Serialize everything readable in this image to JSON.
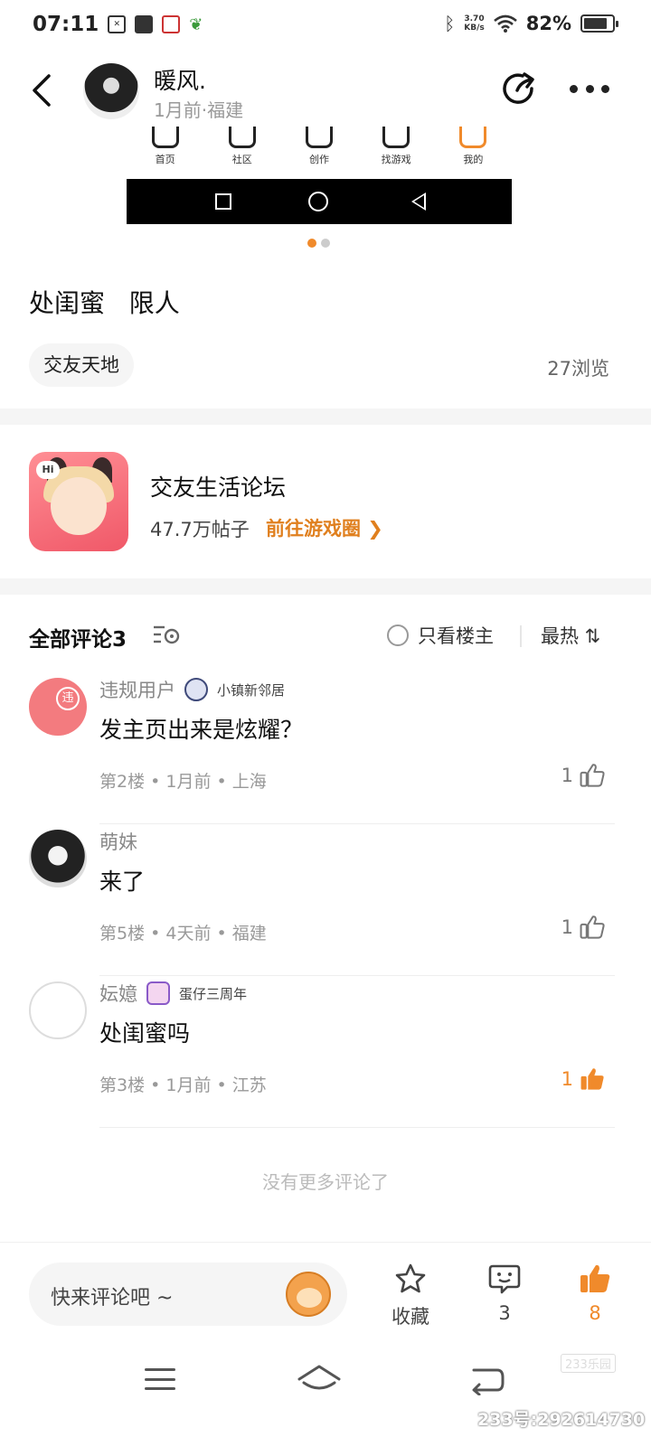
{
  "status_bar": {
    "time": "07:11",
    "speed_value": "3.70",
    "speed_unit": "KB/s",
    "battery_percent": "82%",
    "battery_level": 0.82
  },
  "author": {
    "name": "暖风.",
    "meta": "1月前·福建"
  },
  "embedded_screenshot": {
    "tabs": [
      {
        "label": "首页",
        "icon": "home-icon"
      },
      {
        "label": "社区",
        "icon": "community-icon"
      },
      {
        "label": "创作",
        "icon": "create-icon"
      },
      {
        "label": "找游戏",
        "icon": "gamepad-icon"
      },
      {
        "label": "我的",
        "icon": "profile-icon",
        "active": true
      }
    ]
  },
  "post": {
    "title": "处闺蜜   限人",
    "topic": "交友天地",
    "views": "27浏览"
  },
  "circle": {
    "name": "交友生活论坛",
    "posts": "47.7万帖子",
    "link": "前往游戏圈 ❯",
    "icon_badge": "Hi"
  },
  "comments_header": {
    "title": "全部评论3",
    "only_op": "只看楼主",
    "sort": "最热 ⇅"
  },
  "comments": [
    {
      "name": "违规用户",
      "badge": "小镇新邻居",
      "text": "发主页出来是炫耀？",
      "meta": "第2楼 • 1月前 • 上海",
      "likes": "1",
      "liked": false,
      "avatar_char": "违"
    },
    {
      "name": "萌妹",
      "badge": "",
      "text": "来了",
      "meta": "第5楼 • 4天前 • 福建",
      "likes": "1",
      "liked": false
    },
    {
      "name": "妘嬑",
      "badge": "蛋仔三周年",
      "text": "处闺蜜吗",
      "meta": "第3楼 • 1月前 • 江苏",
      "likes": "1",
      "liked": true
    }
  ],
  "no_more": "没有更多评论了",
  "bottom_bar": {
    "input_placeholder": "快来评论吧 ~",
    "favorite_label": "收藏",
    "comment_count": "3",
    "like_count": "8"
  },
  "watermark": {
    "site": "233乐园",
    "id": "233号:292614730"
  },
  "colors": {
    "accent": "#f08a2b",
    "link": "#e0801f",
    "band": "#f5f5f5"
  }
}
